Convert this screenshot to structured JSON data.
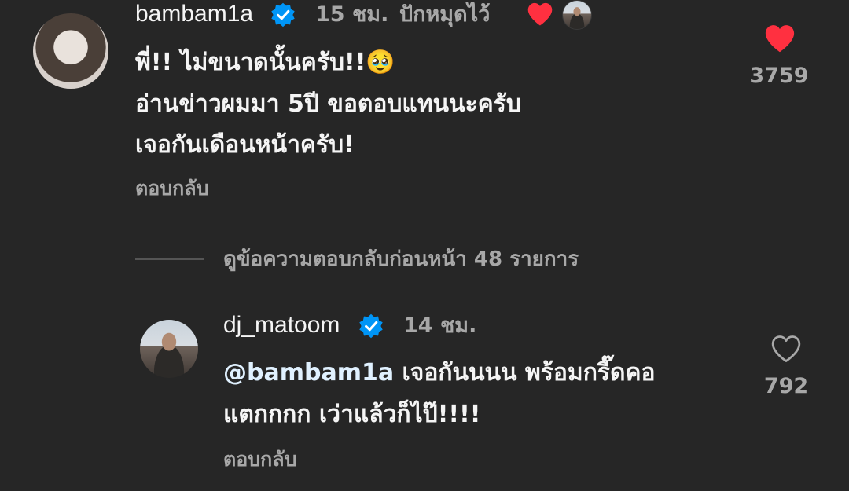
{
  "comment": {
    "username": "bambam1a",
    "time": "15 ชม.",
    "pinned_label": "ปักหมุดไว้",
    "lines": [
      "พี่!! ไม่ขนาดนั้นครับ!!🥹",
      "อ่านข่าวผมมา 5ปี ขอตอบแทนนะครับ",
      "เจอกันเดือนหน้าครับ!"
    ],
    "reply_label": "ตอบกลับ",
    "like_count": "3759",
    "liked": true,
    "creator_liked_icon": "heart-filled-icon"
  },
  "view_previous_replies": "ดูข้อความตอบกลับก่อนหน้า 48 รายการ",
  "reply": {
    "username": "dj_matoom",
    "time": "14 ชม.",
    "mention": "@bambam1a",
    "line1_rest": " เจอกันนนน พร้อมกรี๊ดคอ",
    "line2": "แตกกกก เว่าแล้วก็ไป๊!!!!",
    "reply_label": "ตอบกลับ",
    "like_count": "792",
    "liked": false
  },
  "colors": {
    "background": "#262626",
    "heart_red": "#ff3040",
    "verified_blue": "#0095f6",
    "secondary_text": "#a8a8a8"
  }
}
